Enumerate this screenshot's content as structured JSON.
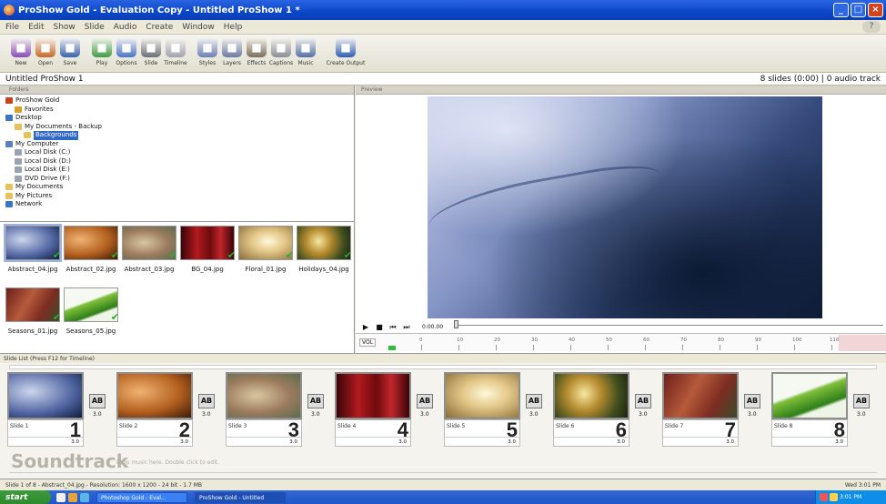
{
  "window": {
    "title": "ProShow Gold - Evaluation Copy - Untitled ProShow 1 *"
  },
  "menu": [
    "File",
    "Edit",
    "Show",
    "Slide",
    "Audio",
    "Create",
    "Window",
    "Help"
  ],
  "toolbar": [
    {
      "label": "New",
      "icon": "new-icon",
      "color": "#8a4db8"
    },
    {
      "label": "Open",
      "icon": "open-icon",
      "color": "#c66a2b"
    },
    {
      "label": "Save",
      "icon": "save-icon",
      "color": "#3a63b0"
    },
    {
      "label": "Play",
      "icon": "play-icon",
      "color": "#3e9c44"
    },
    {
      "label": "Options",
      "icon": "options-icon",
      "color": "#4b74c8"
    },
    {
      "label": "Slide",
      "icon": "slide-icon",
      "color": "#6b6f7a"
    },
    {
      "label": "Timeline",
      "icon": "timeline-icon",
      "color": "#a1a4ae"
    },
    {
      "label": "Styles",
      "icon": "styles-icon",
      "color": "#6e80b9"
    },
    {
      "label": "Layers",
      "icon": "layers-icon",
      "color": "#6c7aa2"
    },
    {
      "label": "Effects",
      "icon": "effects-icon",
      "color": "#7b6e5b"
    },
    {
      "label": "Captions",
      "icon": "captions-icon",
      "color": "#8a8f98"
    },
    {
      "label": "Music",
      "icon": "music-icon",
      "color": "#556fa8"
    },
    {
      "label": "Create Output",
      "icon": "create-output-icon",
      "color": "#2f5fb5"
    }
  ],
  "info": {
    "show_name": "Untitled ProShow 1",
    "summary": "8 slides (0:00) | 0 audio track"
  },
  "folders_tab": "Folders",
  "tree": [
    {
      "label": "ProShow Gold",
      "level": 0,
      "icon": "app-icon",
      "color": "#c7411c"
    },
    {
      "label": "Favorites",
      "level": 1,
      "icon": "favorites-icon",
      "color": "#d9a12c"
    },
    {
      "label": "Desktop",
      "level": 0,
      "icon": "desktop-icon",
      "color": "#3a74c7"
    },
    {
      "label": "My Documents - Backup",
      "level": 1,
      "icon": "folder-icon",
      "color": "#e7c25a"
    },
    {
      "label": "Backgrounds",
      "level": 2,
      "icon": "folder-icon",
      "color": "#e7c25a",
      "selected": true
    },
    {
      "label": "My Computer",
      "level": 0,
      "icon": "computer-icon",
      "color": "#5d7fc1"
    },
    {
      "label": "Local Disk (C:)",
      "level": 1,
      "icon": "drive-icon",
      "color": "#9aa3b2"
    },
    {
      "label": "Local Disk (D:)",
      "level": 1,
      "icon": "drive-icon",
      "color": "#9aa3b2"
    },
    {
      "label": "Local Disk (E:)",
      "level": 1,
      "icon": "drive-icon",
      "color": "#9aa3b2"
    },
    {
      "label": "DVD Drive (F:)",
      "level": 1,
      "icon": "dvd-icon",
      "color": "#9aa3b2"
    },
    {
      "label": "My Documents",
      "level": 0,
      "icon": "folder-icon",
      "color": "#e7c25a"
    },
    {
      "label": "My Pictures",
      "level": 0,
      "icon": "folder-icon",
      "color": "#e7c25a"
    },
    {
      "label": "Network",
      "level": 0,
      "icon": "network-icon",
      "color": "#3a74c7"
    }
  ],
  "files": [
    {
      "name": "Abstract_04.jpg",
      "bg": "radial-gradient(ellipse at 30% 40%,#cdd6ee,#4e63a0 60%,#101c3a)",
      "selected": true
    },
    {
      "name": "Abstract_02.jpg",
      "bg": "radial-gradient(ellipse at 30% 40%,#f0b372,#b4601f 55%,#3b1a07)"
    },
    {
      "name": "Abstract_03.jpg",
      "bg": "radial-gradient(ellipse at 40% 50%,#d9c7a1,#9b7b5d 55%,#5c6b4e)"
    },
    {
      "name": "BG_04.jpg",
      "bg": "linear-gradient(90deg,#3a0508,#b21a1f 30%,#6d0a0d 55%,#c0262b 75%,#3a0508)"
    },
    {
      "name": "Floral_01.jpg",
      "bg": "radial-gradient(ellipse at 55% 45%,#fff8d9,#e4c98a 40%,#8a6b37)"
    },
    {
      "name": "Holidays_04.jpg",
      "bg": "radial-gradient(circle at 40% 45%,#f6e7a0,#b48a2e 35%,#3f4d1f 70%,#1b2410)"
    },
    {
      "name": "Seasons_01.jpg",
      "bg": "linear-gradient(120deg,#6d1f1a,#b65a3b 40%,#7c2c21 70%,#3b4a2c)"
    },
    {
      "name": "Seasons_05.jpg",
      "bg": "linear-gradient(160deg,#f6f9f2 40%,#7fbf3a 45%,#2f7f1a 70%,#eef5e6 75%)"
    }
  ],
  "preview": {
    "tab": "Preview",
    "timecode": "0:00.00",
    "volume": "VOL"
  },
  "ruler": [
    "0",
    "10",
    "20",
    "30",
    "40",
    "50",
    "60",
    "70",
    "80",
    "90",
    "100",
    "110"
  ],
  "slide_list": {
    "header": "Slide List (Press F12 for Timeline)",
    "slides": [
      {
        "name": "Slide 1",
        "num": "1",
        "dur": "3.0",
        "trans_dur": "3.0",
        "bg": "radial-gradient(ellipse at 30% 40%,#cdd6ee,#4e63a0 60%,#101c3a)"
      },
      {
        "name": "Slide 2",
        "num": "2",
        "dur": "3.0",
        "trans_dur": "3.0",
        "bg": "radial-gradient(ellipse at 30% 40%,#f0b372,#b4601f 55%,#3b1a07)"
      },
      {
        "name": "Slide 3",
        "num": "3",
        "dur": "3.0",
        "trans_dur": "3.0",
        "bg": "radial-gradient(ellipse at 40% 50%,#d9c7a1,#9b7b5d 55%,#5c6b4e)"
      },
      {
        "name": "Slide 4",
        "num": "4",
        "dur": "3.0",
        "trans_dur": "3.0",
        "bg": "linear-gradient(90deg,#3a0508,#b21a1f 30%,#6d0a0d 55%,#c0262b 75%,#3a0508)"
      },
      {
        "name": "Slide 5",
        "num": "5",
        "dur": "3.0",
        "trans_dur": "3.0",
        "bg": "radial-gradient(ellipse at 55% 45%,#fff8d9,#e4c98a 40%,#8a6b37)"
      },
      {
        "name": "Slide 6",
        "num": "6",
        "dur": "3.0",
        "trans_dur": "3.0",
        "bg": "radial-gradient(circle at 40% 45%,#f6e7a0,#b48a2e 35%,#3f4d1f 70%,#1b2410)"
      },
      {
        "name": "Slide 7",
        "num": "7",
        "dur": "3.0",
        "trans_dur": "3.0",
        "bg": "linear-gradient(120deg,#6d1f1a,#b65a3b 40%,#7c2c21 70%,#3b4a2c)"
      },
      {
        "name": "Slide 8",
        "num": "8",
        "dur": "3.0",
        "trans_dur": "3.0",
        "bg": "linear-gradient(160deg,#f6f9f2 40%,#7fbf3a 45%,#2f7f1a 70%,#eef5e6 75%)"
      }
    ],
    "transition_label": "AB",
    "soundtrack_label": "Soundtrack",
    "soundtrack_hint": "Drop music here. Double click to edit."
  },
  "status": {
    "left": "Slide 1 of 8 - Abstract_04.jpg - Resolution: 1600 x 1200 - 24 bit - 1.7 MB",
    "right": "Wed 3:01 PM"
  },
  "taskbar": {
    "start": "start",
    "tasks": [
      "Photoshop Gold - Eval...",
      "ProShow Gold - Untitled"
    ],
    "time": "3:01 PM"
  }
}
